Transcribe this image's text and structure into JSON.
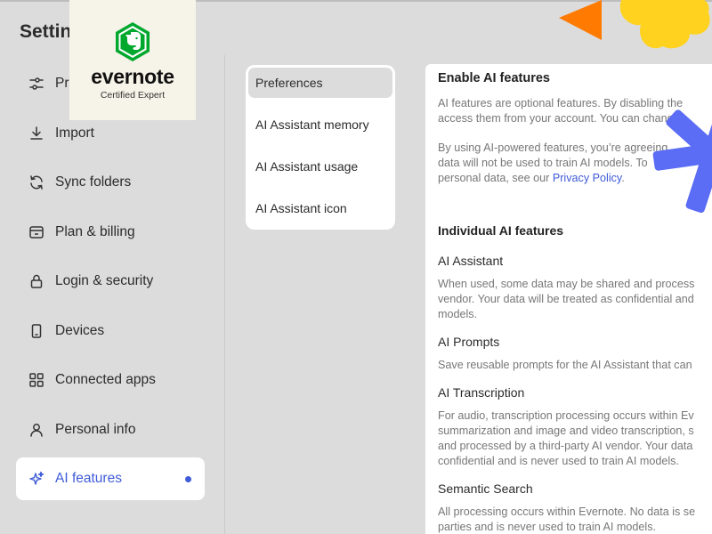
{
  "title": "Settings",
  "badge": {
    "brand": "evernote",
    "subtitle": "Certified Expert"
  },
  "sidebar": {
    "items": [
      {
        "label": "Preferences",
        "icon": "sliders-icon"
      },
      {
        "label": "Import",
        "icon": "download-icon"
      },
      {
        "label": "Sync folders",
        "icon": "sync-icon"
      },
      {
        "label": "Plan & billing",
        "icon": "billing-icon"
      },
      {
        "label": "Login & security",
        "icon": "lock-icon"
      },
      {
        "label": "Devices",
        "icon": "phone-icon"
      },
      {
        "label": "Connected apps",
        "icon": "grid-icon"
      },
      {
        "label": "Personal info",
        "icon": "person-icon"
      },
      {
        "label": "AI features",
        "icon": "sparkle-icon",
        "active": true
      }
    ]
  },
  "submenu": {
    "items": [
      {
        "label": "Preferences",
        "active": true
      },
      {
        "label": "AI Assistant memory"
      },
      {
        "label": "AI Assistant usage"
      },
      {
        "label": "AI Assistant icon"
      }
    ]
  },
  "content": {
    "heading": "Enable AI features",
    "intro": {
      "line1": "AI features are optional features. By disabling the",
      "line2": "access them from your account. You can change"
    },
    "consent": {
      "line1": "By using AI-powered features, you’re agreeing",
      "line2": "data will not be used to train AI models. To",
      "line3_prefix": "personal data, see our ",
      "link": "Privacy Policy",
      "line3_suffix": "."
    },
    "section": "Individual AI features",
    "features": [
      {
        "name": "AI Assistant",
        "lines": [
          "When used, some data may be shared and process",
          "vendor. Your data will be treated as confidential and",
          "models."
        ]
      },
      {
        "name": "AI Prompts",
        "lines": [
          "Save reusable prompts for the AI Assistant that can"
        ]
      },
      {
        "name": "AI Transcription",
        "lines": [
          "For audio, transcription processing occurs within Ev",
          "summarization and image and video transcription, s",
          "and processed by a third-party AI vendor. Your data",
          "confidential and is never used to train AI models."
        ]
      },
      {
        "name": "Semantic Search",
        "lines": [
          "All processing occurs within Evernote. No data is se",
          "parties and is never used to train AI models."
        ]
      }
    ]
  },
  "colors": {
    "accent": "#3f5bd8",
    "brand_green": "#00a82d",
    "deco_orange": "#ff7a00",
    "deco_yellow": "#ffd21f",
    "deco_blue": "#5b6cf5"
  }
}
